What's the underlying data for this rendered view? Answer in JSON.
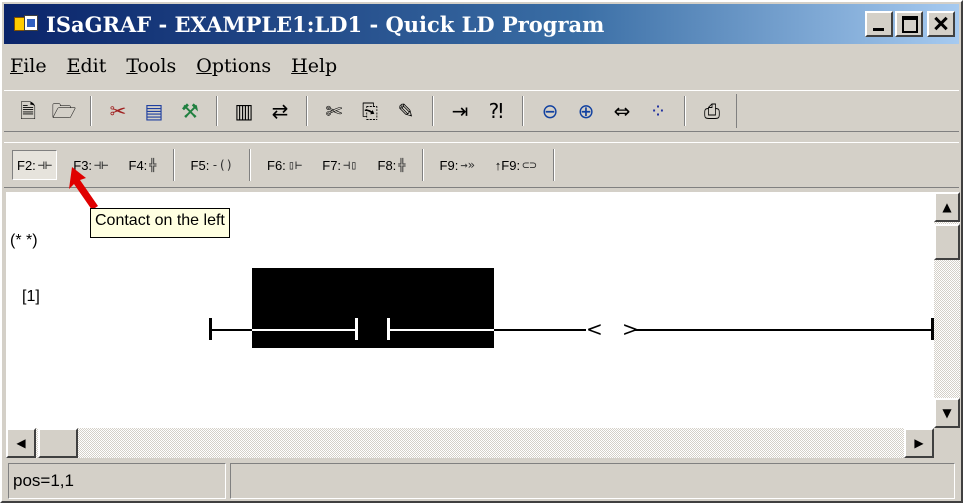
{
  "window": {
    "title": "ISaGRAF - EXAMPLE1:LD1 - Quick LD Program",
    "icon": "isagraf-app-icon"
  },
  "menu": {
    "items": [
      {
        "label": "File",
        "accel": "F"
      },
      {
        "label": "Edit",
        "accel": "E"
      },
      {
        "label": "Tools",
        "accel": "T"
      },
      {
        "label": "Options",
        "accel": "O"
      },
      {
        "label": "Help",
        "accel": "H"
      }
    ]
  },
  "toolbar": {
    "icons": [
      "new-document-icon",
      "open-document-icon",
      "cut-icon",
      "program-icon",
      "wizard-icon",
      "library-icon",
      "link-icon",
      "scissors-icon",
      "copy-icon",
      "paint-icon",
      "insert-icon",
      "check-icon",
      "zoom-out-icon",
      "zoom-in-icon",
      "fit-width-icon",
      "grid-icon",
      "print-icon"
    ]
  },
  "fkeys": {
    "f2": "F2:",
    "f3": "F3:",
    "f4": "F4:",
    "f5": "F5:",
    "f6": "F6:",
    "f7": "F7:",
    "f8": "F8:",
    "f9": "F9:",
    "sf9": "↑F9:"
  },
  "tooltip": "Contact on the left",
  "editor": {
    "comment": "(* *)",
    "rung": "[1]",
    "coil_open": "<",
    "coil_close": ">"
  },
  "status": {
    "position": "pos=1,1",
    "message": ""
  },
  "colors": {
    "title_gradient_start": "#0a246a",
    "title_gradient_end": "#a6caf0",
    "face": "#d4d0c8",
    "tooltip_bg": "#ffffe1",
    "arrow": "#e00000"
  }
}
